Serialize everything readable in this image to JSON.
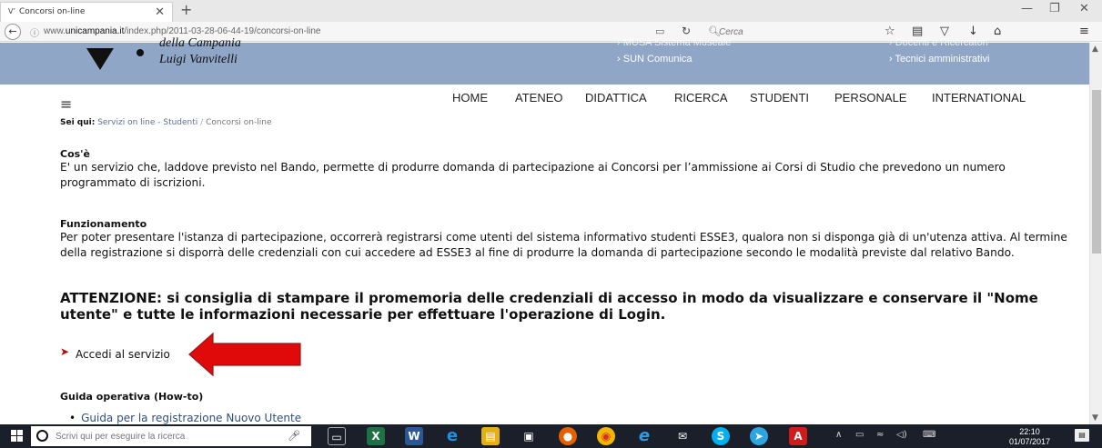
{
  "browser": {
    "tab_title": "Concorsi on-line",
    "tab_favicon": "V\t",
    "url_prefix": "www.",
    "url_domain": "unicampania.it",
    "url_path": "/index.php/2011-03-28-06-44-19/concorsi-on-line",
    "search_placeholder": "Cerca"
  },
  "header": {
    "logo_line_cut": "della Campania",
    "logo_line2": "Luigi Vanvitelli",
    "links_mid": [
      "MUSA Sistema Museale",
      "SUN Comunica"
    ],
    "links_right": [
      "Docenti e Ricercatori",
      "Tecnici amministrativi"
    ]
  },
  "nav": [
    "HOME",
    "ATENEO",
    "DIDATTICA",
    "RICERCA",
    "STUDENTI",
    "PERSONALE",
    "INTERNATIONAL"
  ],
  "breadcrumb": {
    "label": "Sei qui:",
    "items": [
      "Servizi on line - Studenti",
      "Concorsi on-line"
    ]
  },
  "content": {
    "cos_title": "Cos'è",
    "cos_text": "E' un servizio che, laddove previsto nel Bando, permette di produrre domanda di partecipazione ai Concorsi per l’ammissione ai Corsi di Studio che prevedono un numero programmato di iscrizioni.",
    "funz_title": "Funzionamento",
    "funz_text": "Per poter presentare l'istanza di partecipazione, occorrerà registrarsi come utenti del sistema informativo studenti ESSE3, qualora non si disponga già di un'utenza attiva. Al termine della registrazione si disporrà delle credenziali con cui accedere ad ESSE3 al fine di produrre la domanda di partecipazione secondo le modalità previste dal relativo Bando.",
    "warning": "ATTENZIONE: si consiglia di stampare il promemoria delle credenziali di accesso in modo da visualizzare e conservare il \"Nome utente\" e tutte le informazioni necessarie per effettuare l'operazione di Login.",
    "accedi": "Accedi al servizio",
    "guida_title": "Guida operativa (How-to)",
    "guida_items": [
      "Guida per la registrazione Nuovo Utente"
    ]
  },
  "taskbar": {
    "search_placeholder": "Scrivi qui per eseguire la ricerca",
    "time": "22:10",
    "date": "01/07/2017"
  },
  "colors": {
    "header_bg": "#8fa6c6",
    "arrow": "#e10a0a",
    "chevron": "#b01010",
    "taskbar": "#1b1f2a"
  }
}
